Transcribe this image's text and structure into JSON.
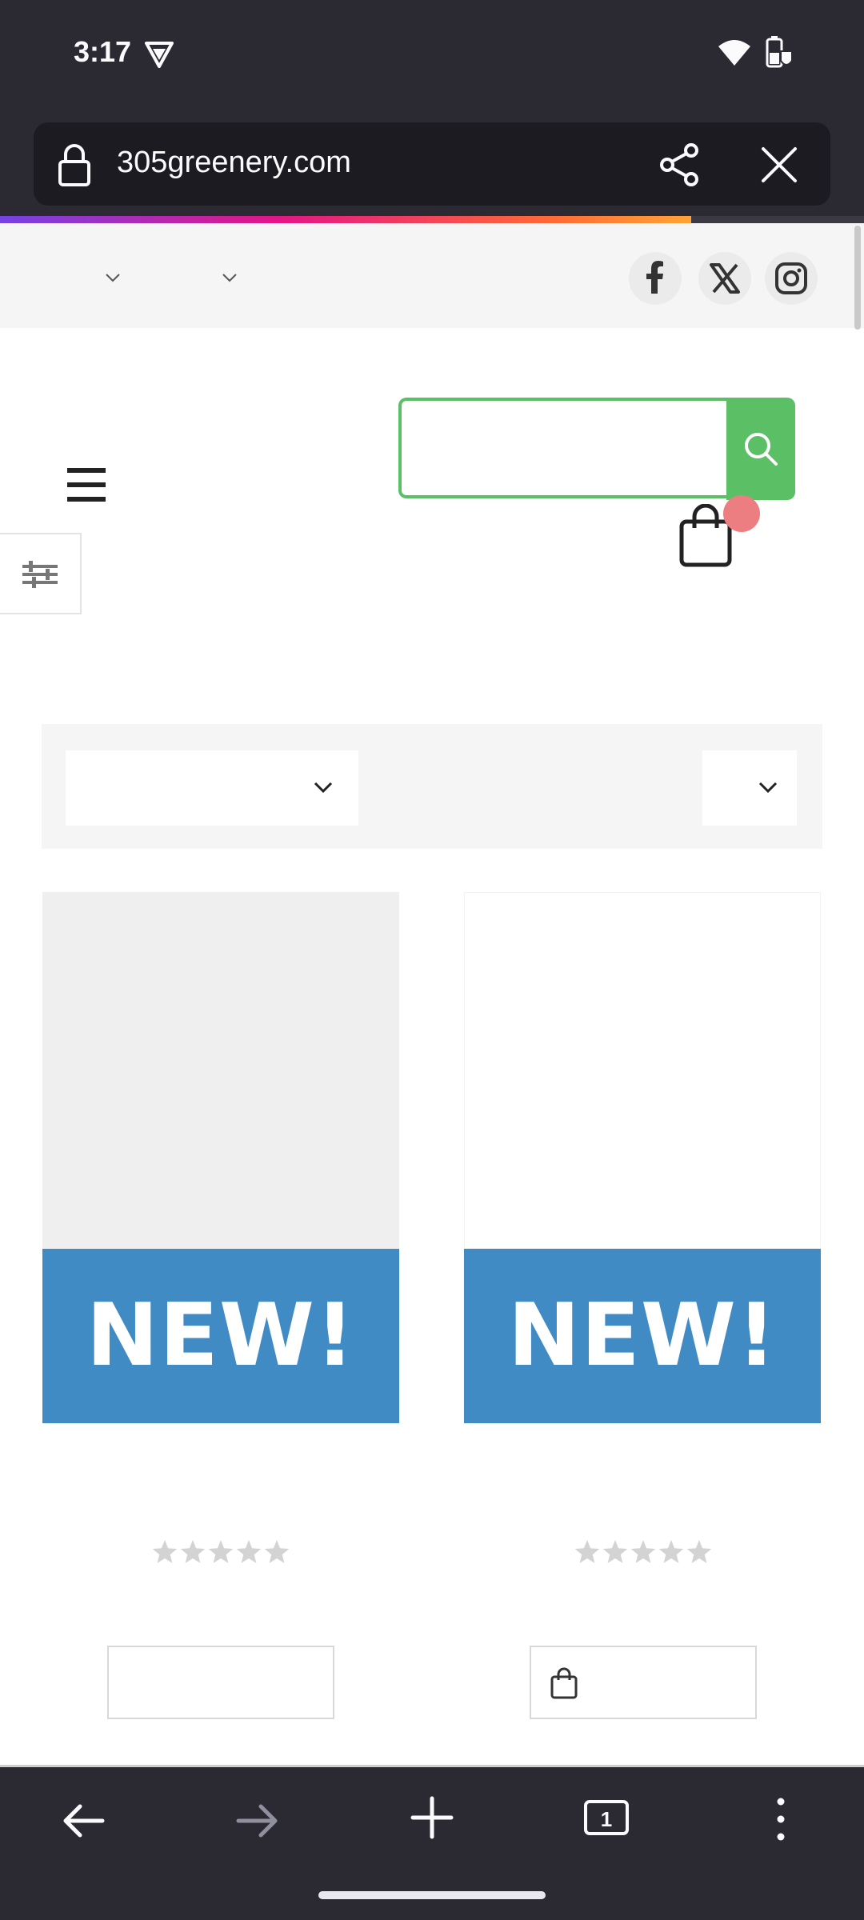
{
  "status_bar": {
    "time": "3:17"
  },
  "browser": {
    "url": "305greenery.com",
    "load_progress_percent": 80,
    "bottom_nav": [
      "back",
      "forward",
      "new-tab",
      "tabs",
      "menu"
    ],
    "tab_count": "1"
  },
  "site": {
    "top_bar": {
      "social": [
        "facebook-icon",
        "x-icon",
        "instagram-icon"
      ]
    },
    "search": {
      "placeholder": ""
    },
    "cart": {
      "badge_color": "#ec7d80"
    },
    "accent_color": "#5bbf66"
  },
  "products": [
    {
      "badge": "NEW!",
      "rating": 0,
      "rating_max": 5
    },
    {
      "badge": "NEW!",
      "rating": 0,
      "rating_max": 5
    }
  ],
  "colors": {
    "new_banner": "#418bc4",
    "browser_chrome": "#2b2a33"
  }
}
